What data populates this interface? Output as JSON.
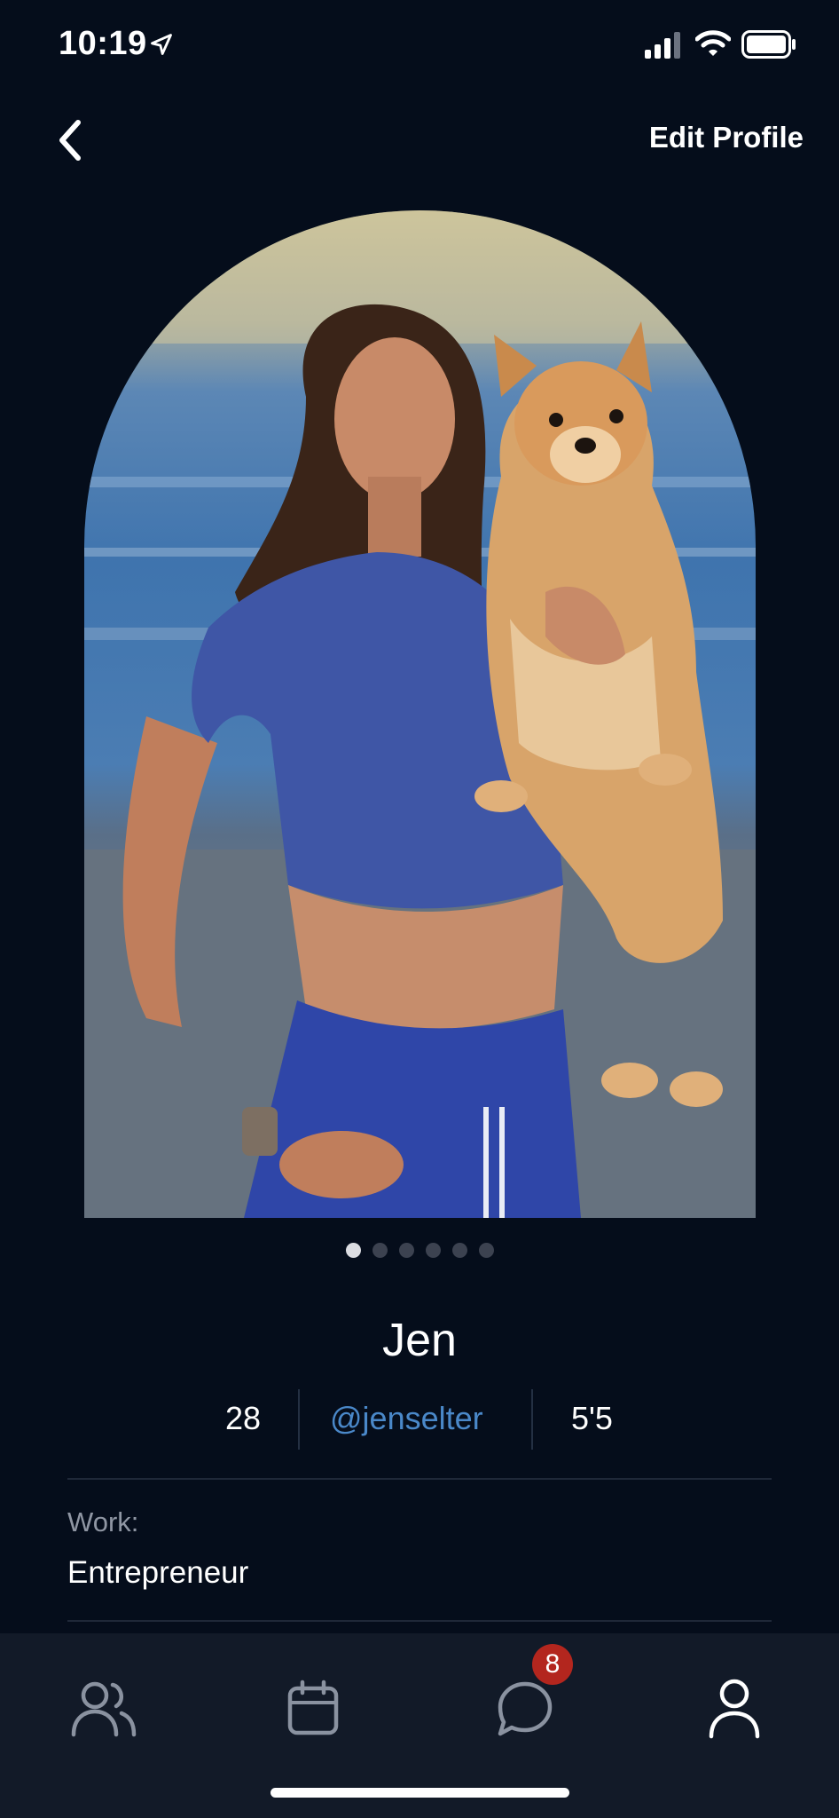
{
  "status_bar": {
    "time": "10:19",
    "icons": [
      "location-arrow-icon",
      "cellular-signal-icon",
      "wifi-icon",
      "battery-icon"
    ]
  },
  "nav": {
    "back_icon": "chevron-left-icon",
    "edit_profile_label": "Edit Profile"
  },
  "photo": {
    "carousel": {
      "count": 6,
      "active_index": 0
    }
  },
  "profile": {
    "name": "Jen",
    "age": "28",
    "handle": "@jenselter",
    "height": "5'5",
    "work_label": "Work:",
    "work_value": "Entrepreneur"
  },
  "tab_bar": {
    "tabs": [
      {
        "icon": "people-icon",
        "active": false
      },
      {
        "icon": "calendar-icon",
        "active": false
      },
      {
        "icon": "chat-bubble-icon",
        "active": false,
        "badge": "8"
      },
      {
        "icon": "person-icon",
        "active": true
      }
    ]
  },
  "colors": {
    "background": "#050d1b",
    "tab_bar": "#121a28",
    "handle_link": "#4a88c9",
    "badge": "#b3261e",
    "muted_text": "#8f96a3"
  }
}
